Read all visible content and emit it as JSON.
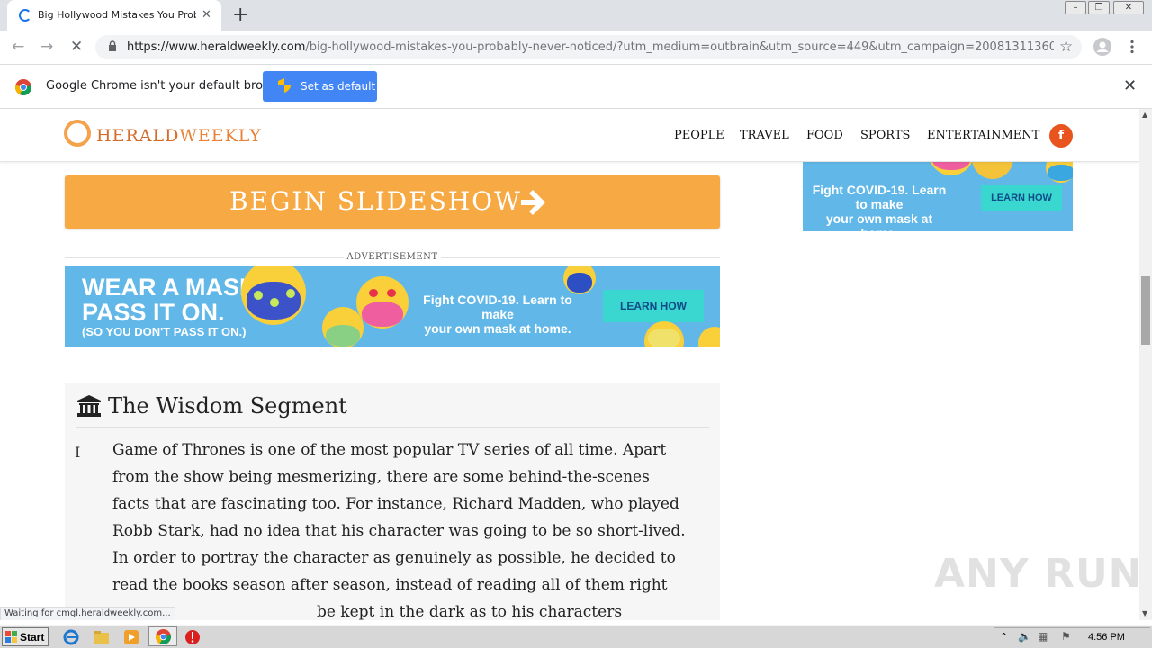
{
  "browser": {
    "tab_title": "Big Hollywood Mistakes You Probably Never Noticed",
    "tab_close": "✕",
    "new_tab": "+",
    "url_host": "https://www.heraldweekly.com",
    "url_path": "/big-hollywood-mistakes-you-probably-never-noticed/?utm_medium=outbrain&utm_source=449&utm_campaign=20081311360717...",
    "infobar_message": "Google Chrome isn't your default browser",
    "infobar_button": "Set as default",
    "status_text": "Waiting for cmgl.heraldweekly.com..."
  },
  "site": {
    "logo_part1": "HERALD",
    "logo_part2": "WEEKLY",
    "nav": [
      "PEOPLE",
      "TRAVEL",
      "FOOD",
      "SPORTS",
      "ENTERTAINMENT"
    ],
    "facebook_letter": "f",
    "slideshow_button": "BEGIN SLIDESHOW",
    "ad_label": "ADVERTISEMENT"
  },
  "ads": {
    "banner_big_line1": "WEAR A MASK.",
    "banner_big_line2": "PASS IT ON.",
    "banner_small": "(SO YOU DON'T PASS IT ON.)",
    "banner_mid_line1": "Fight COVID-19. Learn to make",
    "banner_mid_line2": "your own mask at home.",
    "banner_cta": "LEARN HOW",
    "side_mid_line1": "Fight COVID-19. Learn to make",
    "side_mid_line2": "your own mask at home.",
    "side_cta": "LEARN HOW"
  },
  "wisdom": {
    "heading": "The Wisdom Segment",
    "marker": "I",
    "lines": [
      "Game of Thrones is one of the most popular TV series of all time. Apart",
      "from the show being mesmerizing, there are some behind-the-scenes",
      "facts that are fascinating too. For instance, Richard Madden, who played",
      "Robb Stark, had no idea that his character was going to be so short-lived.",
      "In order to portray the character as genuinely as possible, he decided to",
      "read the books season after season, instead of reading all of them right",
      "                                          be kept in the dark as to his characters"
    ]
  },
  "watermark": "ANY RUN",
  "taskbar": {
    "start": "Start",
    "clock": "4:56 PM"
  },
  "colors": {
    "brand_orange": "#f7a944",
    "logo_orange": "#e98236",
    "ad_blue": "#61b8e8",
    "ad_cta": "#3ad7d0",
    "facebook_red": "#e9531e",
    "chrome_blue": "#4285f4"
  },
  "icons": [
    "loading-spinner-icon",
    "back-icon",
    "forward-icon",
    "stop-icon",
    "lock-icon",
    "star-icon",
    "profile-icon",
    "menu-icon",
    "chrome-logo-icon",
    "shield-icon",
    "close-icon",
    "facebook-icon",
    "arrow-right-icon",
    "museum-icon",
    "windows-flag-icon",
    "ie-icon",
    "folder-icon",
    "media-player-icon",
    "chrome-icon",
    "opera-icon"
  ]
}
